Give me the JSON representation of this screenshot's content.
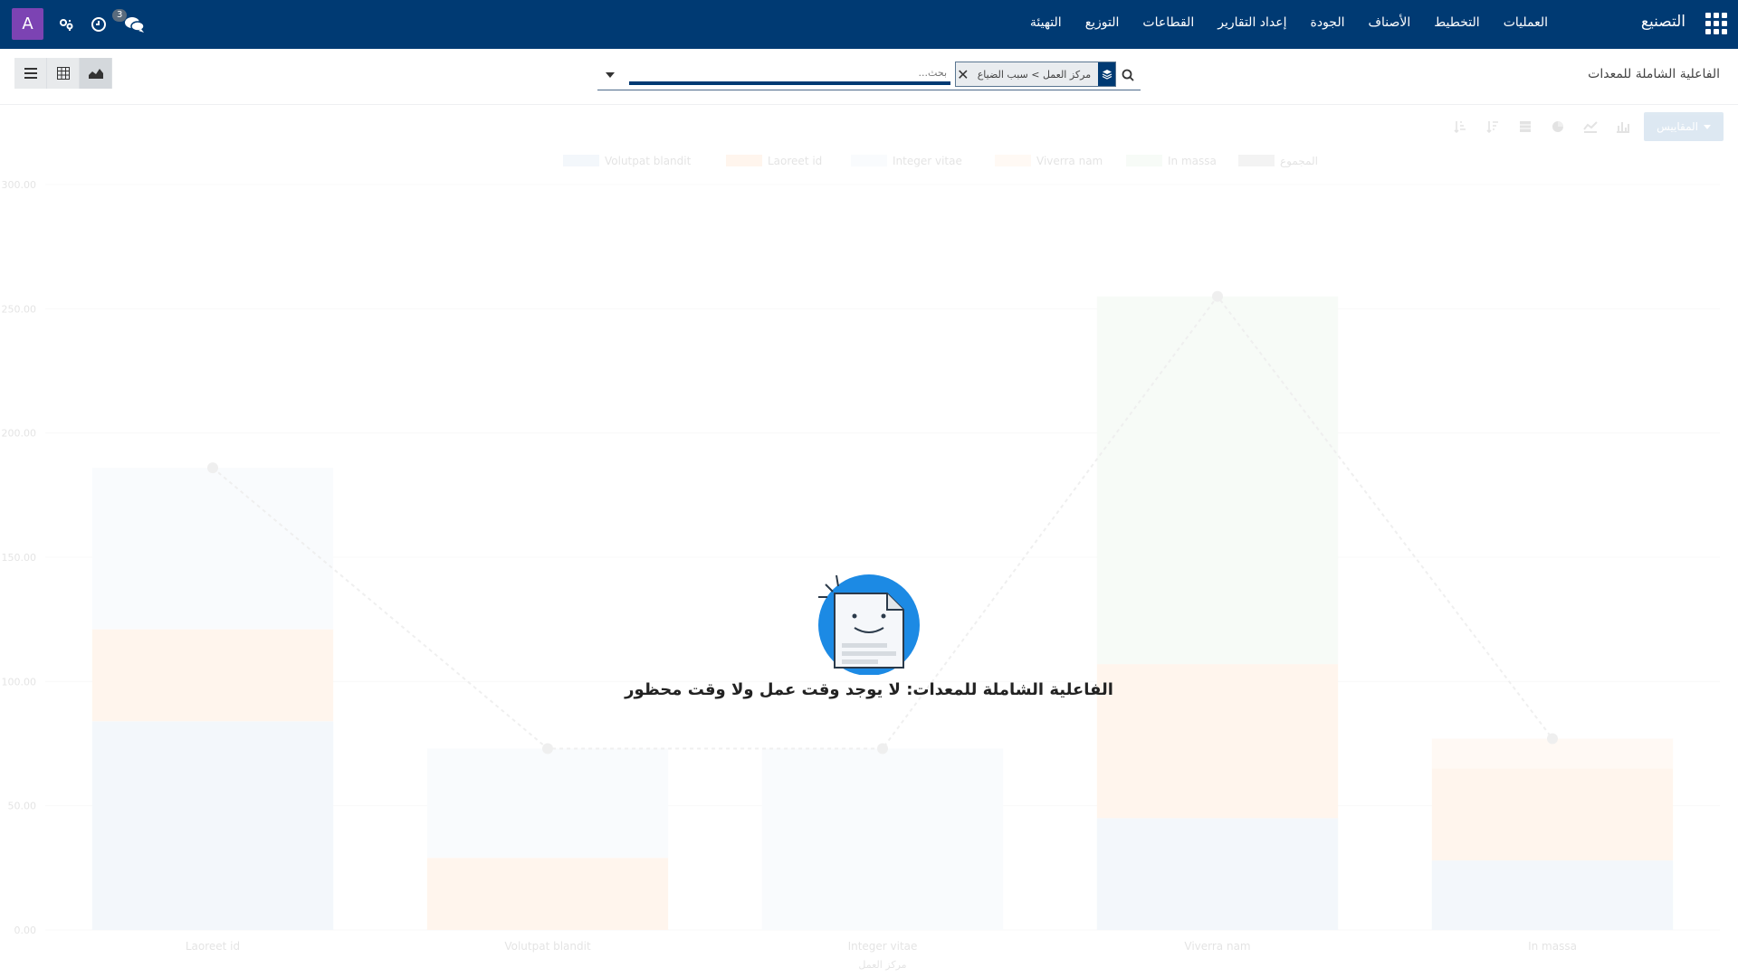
{
  "navbar": {
    "brand": "التصنيع",
    "menu": [
      "العمليات",
      "التخطيط",
      "الأصناف",
      "الجودة",
      "إعداد التقارير",
      "القطاعات",
      "التوزيع",
      "التهيئة"
    ],
    "avatar_letter": "A",
    "messages_count": "3",
    "bar_color": "#003a73"
  },
  "control": {
    "title": "الفاعلية الشاملة للمعدات",
    "search": {
      "facet_text": "مركز العمل > سبب الضياع",
      "placeholder": "بحث..."
    }
  },
  "graph": {
    "measures_label": "المقاييس"
  },
  "chart_data": {
    "type": "bar",
    "stacked": true,
    "categories": [
      "Laoreet id",
      "Volutpat blandit",
      "Integer vitae",
      "Viverra nam",
      "In massa"
    ],
    "series": [
      {
        "name": "Volutpat blandit",
        "color": "#a6c8e8",
        "values": [
          84,
          0,
          0,
          45,
          28
        ]
      },
      {
        "name": "Laoreet id",
        "color": "#ffbb78",
        "values": [
          37,
          29,
          0,
          62,
          37
        ]
      },
      {
        "name": "Integer vitae",
        "color": "#d9e8f5",
        "values": [
          65,
          44,
          73,
          0,
          0
        ]
      },
      {
        "name": "Viverra nam",
        "color": "#ffd9b0",
        "values": [
          0,
          0,
          0,
          0,
          12
        ]
      },
      {
        "name": "In massa",
        "color": "#c5e3c5",
        "values": [
          0,
          0,
          0,
          148,
          0
        ]
      }
    ],
    "sum_series": {
      "name": "المجموع",
      "values": [
        186,
        73,
        73,
        255,
        77
      ]
    },
    "ylim": [
      0,
      300
    ],
    "yticks": [
      "0.00",
      "50.00",
      "100.00",
      "150.00",
      "200.00",
      "250.00",
      "300.00"
    ],
    "xlabel": "مركز العمل",
    "legend_position": "top",
    "grid": true
  },
  "nocontent": {
    "title": "الفاعلية الشاملة للمعدات: لا يوجد وقت عمل ولا وقت محظور"
  }
}
